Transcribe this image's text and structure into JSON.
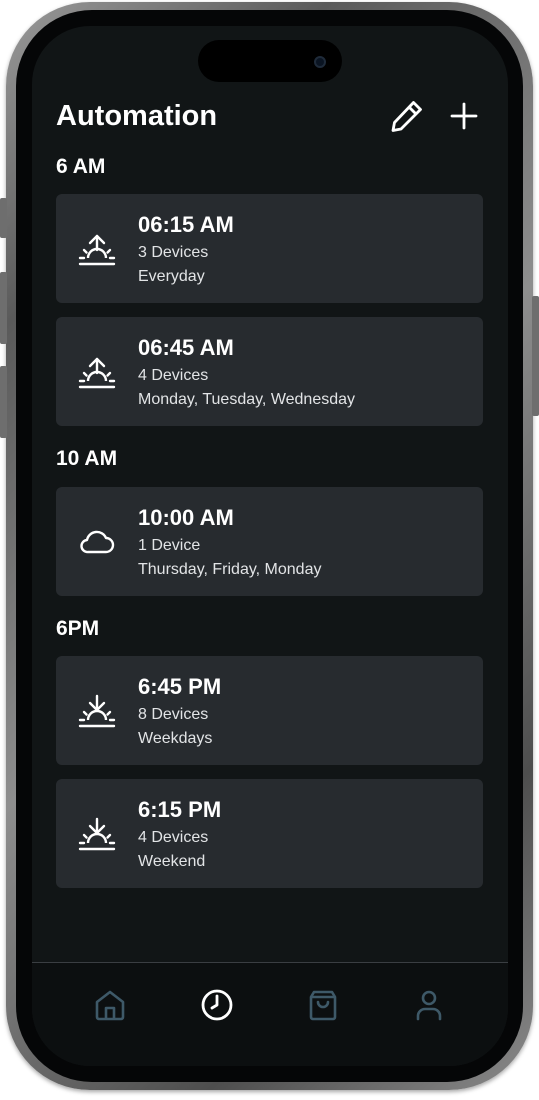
{
  "app": {
    "title": "Automation"
  },
  "header_actions": {
    "edit_icon": "pencil-icon",
    "add_icon": "plus-icon"
  },
  "sections": [
    {
      "label": "6 AM",
      "items": [
        {
          "time": "06:15 AM",
          "devices": "3 Devices",
          "days": "Everyday",
          "icon": "sunrise-icon"
        },
        {
          "time": "06:45 AM",
          "devices": "4 Devices",
          "days": "Monday, Tuesday, Wednesday",
          "icon": "sunrise-icon"
        }
      ]
    },
    {
      "label": "10 AM",
      "items": [
        {
          "time": "10:00 AM",
          "devices": "1 Device",
          "days": "Thursday, Friday, Monday",
          "icon": "cloud-icon"
        }
      ]
    },
    {
      "label": "6PM",
      "items": [
        {
          "time": "6:45 PM",
          "devices": "8 Devices",
          "days": "Weekdays",
          "icon": "sunset-icon"
        },
        {
          "time": "6:15 PM",
          "devices": "4 Devices",
          "days": "Weekend",
          "icon": "sunset-icon"
        }
      ]
    }
  ],
  "bottom_nav": {
    "active": "clock",
    "items": [
      "home-icon",
      "clock-icon",
      "shopping-bag-icon",
      "user-icon"
    ]
  },
  "colors": {
    "background": "#111516",
    "card": "#272b2f",
    "text": "#ffffff",
    "nav_inactive": "#3e5968",
    "nav_active": "#ffffff"
  }
}
